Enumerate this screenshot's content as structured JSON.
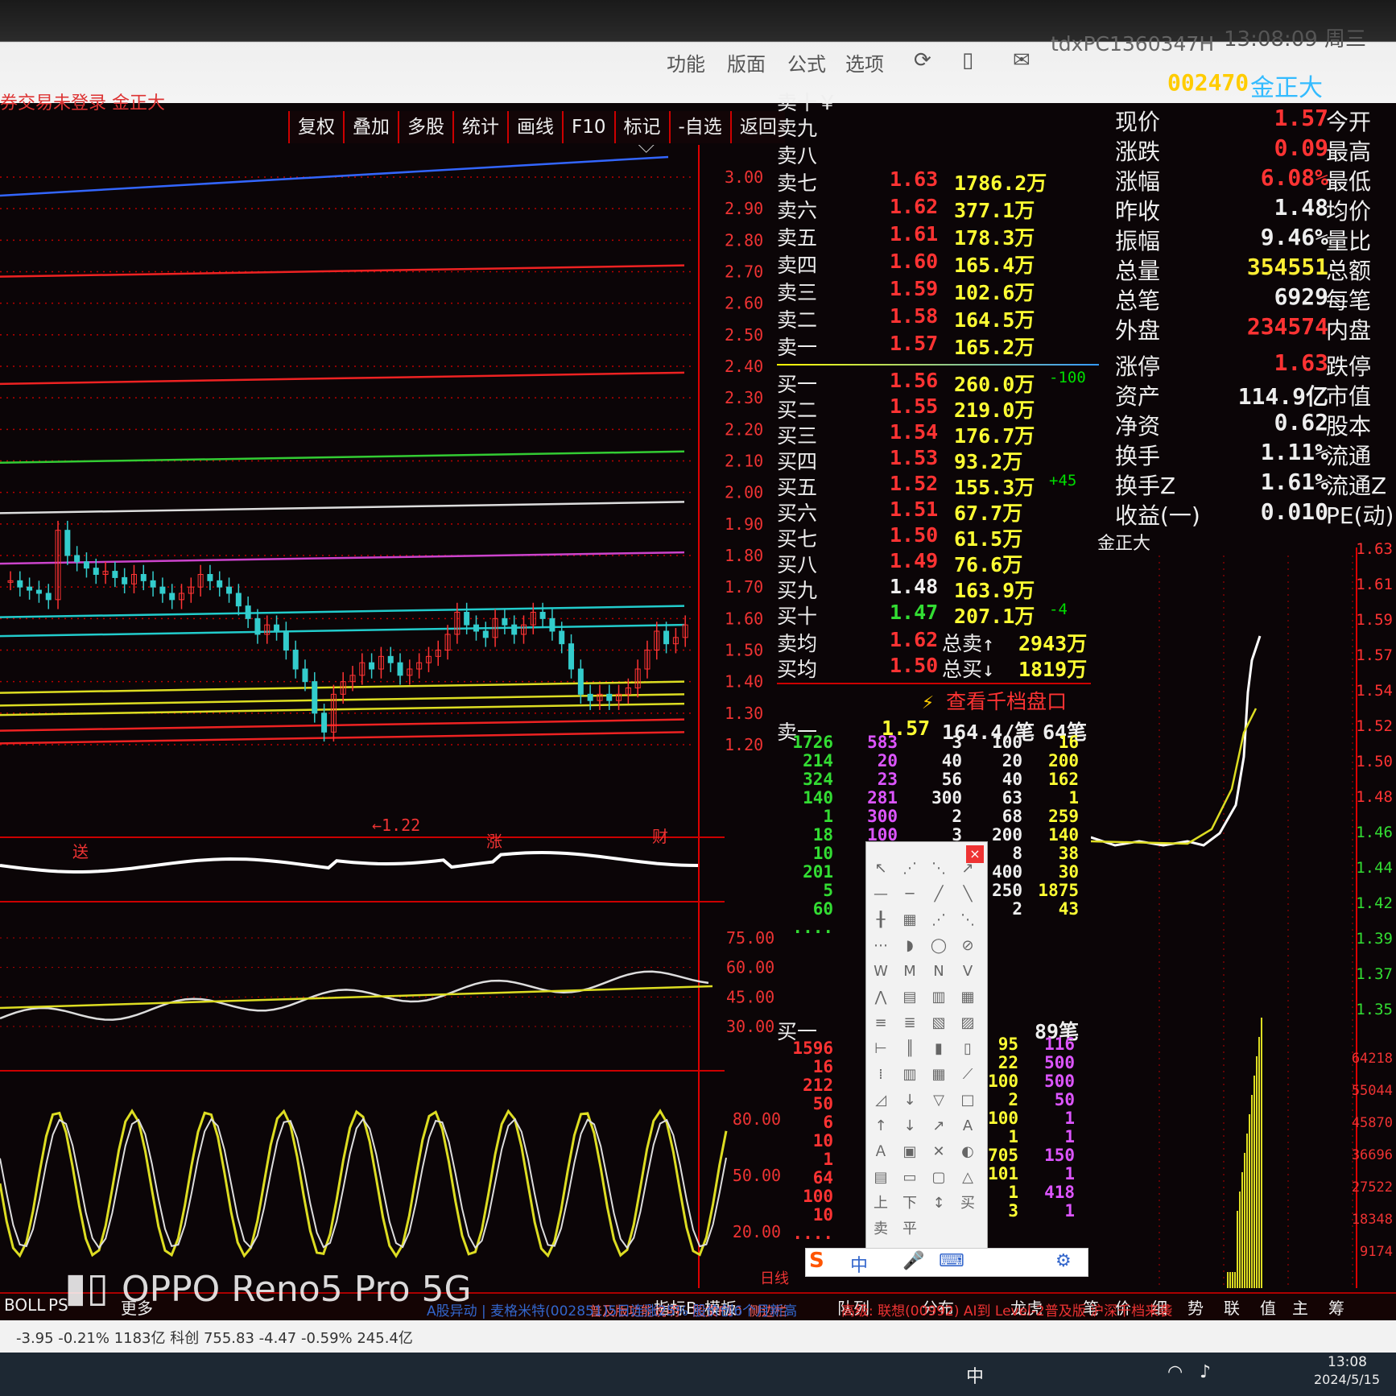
{
  "window": {
    "menu": [
      "功能",
      "版面",
      "公式",
      "选项"
    ],
    "account": "tdxPC1360347H",
    "clock": "13:08:09 周三",
    "status": "券交易未登录  金正大"
  },
  "toolbar": [
    "复权",
    "叠加",
    "多股",
    "统计",
    "画线",
    "F10",
    "标记",
    "-自选",
    "返回"
  ],
  "chart_data": {
    "type": "line",
    "main_axis": [
      "3.00",
      "2.90",
      "2.80",
      "2.70",
      "2.60",
      "2.50",
      "2.40",
      "2.30",
      "2.20",
      "2.10",
      "2.00",
      "1.90",
      "1.80",
      "1.70",
      "1.60",
      "1.50",
      "1.40",
      "1.30",
      "1.20"
    ],
    "low_marker": "←1.22",
    "markers": [
      "涨",
      "财",
      "送"
    ],
    "rsi_axis": [
      "75.00",
      "60.00",
      "45.00",
      "30.00"
    ],
    "kdj_axis": [
      "80.00",
      "50.00",
      "20.00"
    ],
    "bottom_label": "日线",
    "close_prices": [
      1.72,
      1.7,
      1.69,
      1.68,
      1.66,
      1.88,
      1.8,
      1.78,
      1.76,
      1.74,
      1.75,
      1.73,
      1.71,
      1.74,
      1.72,
      1.7,
      1.68,
      1.66,
      1.68,
      1.7,
      1.74,
      1.72,
      1.7,
      1.68,
      1.64,
      1.6,
      1.55,
      1.58,
      1.56,
      1.5,
      1.44,
      1.4,
      1.3,
      1.24,
      1.36,
      1.4,
      1.42,
      1.46,
      1.44,
      1.48,
      1.46,
      1.42,
      1.44,
      1.46,
      1.48,
      1.5,
      1.55,
      1.62,
      1.58,
      1.56,
      1.54,
      1.6,
      1.58,
      1.55,
      1.58,
      1.62,
      1.6,
      1.56,
      1.52,
      1.44,
      1.36,
      1.34,
      1.36,
      1.34,
      1.36,
      1.38,
      1.44,
      1.5,
      1.56,
      1.52,
      1.54,
      1.58
    ]
  },
  "orderbook": {
    "top_label": "卖十￥",
    "asks": [
      {
        "label": "卖九",
        "price": "",
        "vol": "",
        "chg": ""
      },
      {
        "label": "卖八",
        "price": "",
        "vol": "",
        "chg": ""
      },
      {
        "label": "卖七",
        "price": "1.63",
        "vol": "1786.2万",
        "chg": ""
      },
      {
        "label": "卖六",
        "price": "1.62",
        "vol": "377.1万",
        "chg": ""
      },
      {
        "label": "卖五",
        "price": "1.61",
        "vol": "178.3万",
        "chg": ""
      },
      {
        "label": "卖四",
        "price": "1.60",
        "vol": "165.4万",
        "chg": ""
      },
      {
        "label": "卖三",
        "price": "1.59",
        "vol": "102.6万",
        "chg": ""
      },
      {
        "label": "卖二",
        "price": "1.58",
        "vol": "164.5万",
        "chg": ""
      },
      {
        "label": "卖一",
        "price": "1.57",
        "vol": "165.2万",
        "chg": ""
      }
    ],
    "bids": [
      {
        "label": "买一",
        "price": "1.56",
        "vol": "260.0万",
        "chg": "-100"
      },
      {
        "label": "买二",
        "price": "1.55",
        "vol": "219.0万",
        "chg": ""
      },
      {
        "label": "买三",
        "price": "1.54",
        "vol": "176.7万",
        "chg": ""
      },
      {
        "label": "买四",
        "price": "1.53",
        "vol": "93.2万",
        "chg": ""
      },
      {
        "label": "买五",
        "price": "1.52",
        "vol": "155.3万",
        "chg": "+45"
      },
      {
        "label": "买六",
        "price": "1.51",
        "vol": "67.7万",
        "chg": ""
      },
      {
        "label": "买七",
        "price": "1.50",
        "vol": "61.5万",
        "chg": ""
      },
      {
        "label": "买八",
        "price": "1.49",
        "vol": "76.6万",
        "chg": ""
      },
      {
        "label": "买九",
        "price": "1.48",
        "vol": "163.9万",
        "chg": ""
      },
      {
        "label": "买十",
        "price": "1.47",
        "vol": "207.1万",
        "chg": "-4"
      }
    ],
    "avg_sell": {
      "label": "卖均",
      "price": "1.62",
      "tag": "总卖↑",
      "vol": "2943万"
    },
    "avg_buy": {
      "label": "买均",
      "price": "1.50",
      "tag": "总买↓",
      "vol": "1819万"
    },
    "thousand_link": "查看千档盘口",
    "sell1_summary": {
      "label": "卖一",
      "price": "1.57",
      "vol": "164.4/笔",
      "count": "64笔"
    },
    "buy1_summary": {
      "label": "买一",
      "count": "89笔"
    }
  },
  "sell_queue": {
    "c1": [
      "1726",
      "214",
      "324",
      "140",
      "1",
      "18",
      "10",
      "201",
      "5",
      "60",
      "...."
    ],
    "c2": [
      "583",
      "20",
      "23",
      "281",
      "300",
      "100"
    ],
    "c3": [
      "3",
      "40",
      "56",
      "300",
      "2",
      "3"
    ],
    "c4": [
      "100",
      "20",
      "40",
      "63",
      "68",
      "200",
      "8",
      "400",
      "250",
      "2"
    ],
    "c5": [
      "16",
      "200",
      "162",
      "1",
      "259",
      "140",
      "38",
      "30",
      "1875",
      "43"
    ]
  },
  "buy_queue": {
    "c1": [
      "1596",
      "16",
      "212",
      "50",
      "6",
      "10",
      "1",
      "64",
      "100",
      "10",
      "...."
    ],
    "c4": [
      "95",
      "22",
      "100",
      "2",
      "100",
      "1",
      "705",
      "101",
      "1",
      "3"
    ],
    "c5": [
      "116",
      "500",
      "500",
      "50",
      "1",
      "1",
      "150",
      "1",
      "418",
      "1"
    ]
  },
  "quote": {
    "code": "002470",
    "name": "金正大",
    "rows": [
      {
        "label": "现价",
        "value": "1.57",
        "label2": "今开",
        "color": "#ff3333"
      },
      {
        "label": "涨跌",
        "value": "0.09",
        "label2": "最高",
        "color": "#ff3333"
      },
      {
        "label": "涨幅",
        "value": "6.08%",
        "label2": "最低",
        "color": "#ff3333"
      },
      {
        "label": "昨收",
        "value": "1.48",
        "label2": "均价",
        "color": "#eeeeee"
      },
      {
        "label": "振幅",
        "value": "9.46%",
        "label2": "量比",
        "color": "#eeeeee"
      },
      {
        "label": "总量",
        "value": "354551",
        "label2": "总额",
        "color": "#ffee33"
      },
      {
        "label": "总笔",
        "value": "6929",
        "label2": "每笔",
        "color": "#eeeeee"
      },
      {
        "label": "外盘",
        "value": "234574",
        "label2": "内盘",
        "color": "#ff3333"
      },
      {
        "label": "涨停",
        "value": "1.63",
        "label2": "跌停",
        "color": "#ff3333"
      },
      {
        "label": "资产",
        "value": "114.9亿",
        "label2": "市值",
        "color": "#eeeeee"
      },
      {
        "label": "净资",
        "value": "0.62",
        "label2": "股本",
        "color": "#eeeeee"
      },
      {
        "label": "换手",
        "value": "1.11%",
        "label2": "流通",
        "color": "#eeeeee"
      },
      {
        "label": "换手Z",
        "value": "1.61%",
        "label2": "流通Z",
        "color": "#eeeeee"
      },
      {
        "label": "收益(一)",
        "value": "0.010",
        "label2": "PE(动)",
        "color": "#eeeeee"
      }
    ]
  },
  "mini_chart": {
    "title": "金正大",
    "price_axis": [
      "1.63",
      "1.61",
      "1.59",
      "1.57",
      "1.54",
      "1.52",
      "1.50",
      "1.48",
      "1.46",
      "1.44",
      "1.42",
      "1.39",
      "1.37",
      "1.35"
    ],
    "volume_axis": [
      "64218",
      "55044",
      "45870",
      "36696",
      "27522",
      "18348",
      "9174"
    ]
  },
  "bottom_tabs": [
    "BOLL",
    "PS",
    "更多",
    "指标B",
    "模板",
    "普及版功能说明",
    "图文F10",
    "侧边栏",
    "队列",
    "分布",
    "龙虎",
    "笔",
    "价",
    "细",
    "势",
    "联",
    "值",
    "主",
    "筹"
  ],
  "ticker": {
    "left": "-3.95  -0.21% 1183亿 科创 755.83  -4.47  -0.59% 245.4亿",
    "mid": "A股异动 | 麦格米特(002851)5日连涨25% 股价创6个月新高",
    "right": "高级: 联想(00992) AI到 Level-2普及版 沪深千档来袭"
  },
  "taskbar": {
    "time": "13:08",
    "date": "2024/5/15"
  },
  "watermark": "OPPO Reno5 Pro 5G",
  "ime": {
    "label": "中"
  }
}
